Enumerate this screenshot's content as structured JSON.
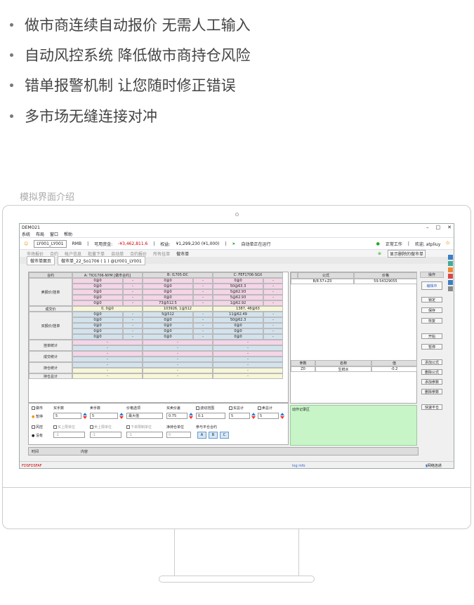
{
  "features": [
    "做市商连续自动报价 无需人工输入",
    "自动风控系统 降低做市商持仓风险",
    "错单报警机制 让您随时修正错误",
    "多市场无缝连接对冲"
  ],
  "caption": "模拟界面介绍",
  "app": {
    "title": "DEMO21",
    "menu": [
      "系统",
      "布局",
      "窗口",
      "帮助"
    ],
    "account": "LY001_LY001",
    "currency": "RMB",
    "available_label": "可用资金:",
    "available_value": "-¥3,462,811.6",
    "equity_label": "权益:",
    "equity_value": "¥1,299,230 (¥1,000)",
    "auto_status": "自动单正在运行",
    "work_status": "正常工作",
    "welcome": "欢迎, atpliuy",
    "toolbar": [
      "市场报价",
      "合约",
      "帐户信息",
      "批量下单",
      "自动单",
      "合约报价",
      "所有挂单",
      "做市单"
    ],
    "show_deleted": "显示删除的做市单",
    "tabs": [
      "做市单面页",
      "做市单_22_So1706 ( 1 ) @LY001_LY001"
    ],
    "contract_label": "合约",
    "contracts": [
      "A: TIO1706-NYM [做市合约]",
      "B: I1705-DC",
      "C: FEF1706-SGX"
    ],
    "row_labels": [
      "卖报价/挂单",
      "成交价",
      "买报价/挂单",
      "挂单统计",
      "成交统计",
      "持仓统计",
      "持仓总计"
    ],
    "sell": [
      [
        "0@0",
        "-",
        "0@0",
        "-",
        "0@0",
        "-"
      ],
      [
        "0@0",
        "-",
        "0@0",
        "-",
        "50@63.3",
        "-"
      ],
      [
        "0@0",
        "-",
        "0@0",
        "-",
        "5@62.93",
        "-"
      ],
      [
        "0@0",
        "-",
        "0@0",
        "-",
        "5@62.93",
        "-"
      ],
      [
        "0@0",
        "-",
        "73@512.5",
        "-",
        "1@62.92",
        "-"
      ]
    ],
    "trade": [
      "0, 0@0",
      "103926, 1@512",
      "1387, 48@63"
    ],
    "buy": [
      [
        "0@0",
        "-",
        "5@512",
        "-",
        "11@62.49",
        "-"
      ],
      [
        "0@0",
        "-",
        "0@0",
        "-",
        "50@62.3",
        "-"
      ],
      [
        "0@0",
        "-",
        "0@0",
        "-",
        "0@0",
        "-"
      ],
      [
        "0@0",
        "-",
        "0@0",
        "-",
        "0@0",
        "-"
      ],
      [
        "0@0",
        "-",
        "0@0",
        "-",
        "0@0",
        "-"
      ]
    ],
    "formula_header": [
      "公式",
      "价格"
    ],
    "formula_row": [
      "B/8.57+Z0",
      "59.54329055"
    ],
    "param_header": [
      "参数",
      "名称",
      "值"
    ],
    "param_row": [
      "Z0",
      "生鲜水",
      "-0.2"
    ],
    "ops_title": "操作",
    "ops": [
      "编辑中",
      "锁定",
      "保存",
      "恢复",
      "开始",
      "暂停",
      "添加公式",
      "删除公式",
      "添加参数",
      "删除参数",
      "快速平仓"
    ],
    "form": {
      "market_making": "做市",
      "pause": "暂停",
      "buy_qty_label": "买手数",
      "buy_qty": "5",
      "sell_qty_label": "卖手数",
      "sell_qty": "5",
      "price_opt_label": "价格选项",
      "price_opt": "最大值",
      "spread_label": "买卖价差",
      "spread": "0.75",
      "float_label": "波动范围",
      "float": "0.1",
      "buy_total_label": "买总计",
      "buy_total": "5",
      "sell_total_label": "卖总计",
      "sell_total": "5",
      "risk": "风控",
      "none": "没有",
      "buy_cap_label": "买上限单位",
      "buy_cap": "-1",
      "sell_cap_label": "卖上限单位",
      "sell_cap": "-1",
      "lower_cap_label": "下单限制单位",
      "lower_cap": "-1",
      "net_label": "净持仓单位",
      "net": "0",
      "close_label": "参与平仓合约",
      "abc": [
        "A",
        "B",
        "C"
      ]
    },
    "log_title": "动作记录区",
    "bottom_cols": [
      "时间",
      "内容"
    ],
    "status_left": "FDSFDSFAF",
    "status_mid": "log info",
    "status_right": "网络连通"
  }
}
